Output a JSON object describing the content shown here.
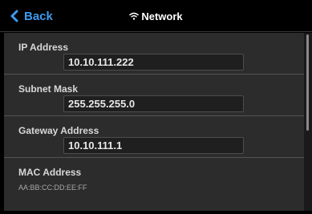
{
  "header": {
    "back_label": "Back",
    "title": "Network",
    "back_icon": "chevron-left-icon",
    "title_icon": "wifi-icon"
  },
  "colors": {
    "accent": "#3d9bf0",
    "background": "#000000",
    "panel": "#2c2c2c"
  },
  "fields": [
    {
      "label": "IP Address",
      "value": "10.10.111.222"
    },
    {
      "label": "Subnet Mask",
      "value": "255.255.255.0"
    },
    {
      "label": "Gateway Address",
      "value": "10.10.111.1"
    }
  ],
  "mac": {
    "label": "MAC Address",
    "value": "AA:BB:CC:DD:EE:FF"
  }
}
